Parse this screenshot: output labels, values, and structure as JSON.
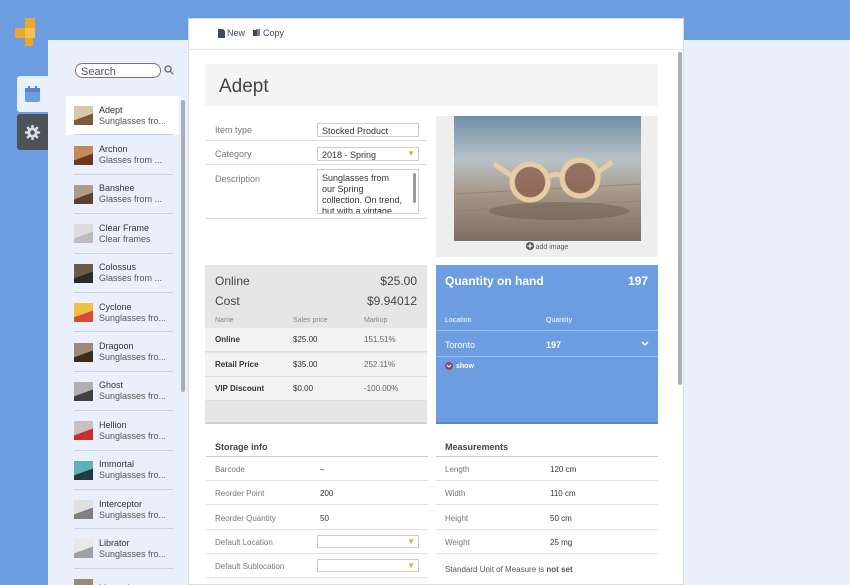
{
  "search": {
    "placeholder": "Search"
  },
  "toolbar": {
    "new_label": "New",
    "copy_label": "Copy"
  },
  "items": [
    {
      "name": "Adept",
      "desc": "Sunglasses fro...",
      "selected": true,
      "thumb": [
        "#d8c8a8",
        "#7a5a3a"
      ]
    },
    {
      "name": "Archon",
      "desc": "Glasses from ...",
      "thumb": [
        "#c58a5a",
        "#6a3a20"
      ]
    },
    {
      "name": "Banshee",
      "desc": "Glasses from ...",
      "thumb": [
        "#b09a8a",
        "#5a4030"
      ]
    },
    {
      "name": "Clear Frame",
      "desc": "Clear frames",
      "thumb": [
        "#dcdcdc",
        "#bcbcbc"
      ]
    },
    {
      "name": "Colossus",
      "desc": "Glasses from ...",
      "thumb": [
        "#6a5a4a",
        "#2a2a2a"
      ]
    },
    {
      "name": "Cyclone",
      "desc": "Sunglasses fro...",
      "thumb": [
        "#f0c040",
        "#d84a3a"
      ]
    },
    {
      "name": "Dragoon",
      "desc": "Sunglasses fro...",
      "thumb": [
        "#a08878",
        "#3a2a20"
      ]
    },
    {
      "name": "Ghost",
      "desc": "Sunglasses fro...",
      "thumb": [
        "#b0b0b0",
        "#404040"
      ]
    },
    {
      "name": "Hellion",
      "desc": "Sunglasses fro...",
      "thumb": [
        "#c8c0c0",
        "#c83030"
      ]
    },
    {
      "name": "Immortal",
      "desc": "Sunglasses fro...",
      "thumb": [
        "#60b0b8",
        "#203a40"
      ]
    },
    {
      "name": "Interceptor",
      "desc": "Sunglasses fro...",
      "thumb": [
        "#e0e0e0",
        "#808080"
      ]
    },
    {
      "name": "Librator",
      "desc": "Sunglasses fro...",
      "thumb": [
        "#e8e8e8",
        "#a0a0a0"
      ]
    },
    {
      "name": "Marauder",
      "desc": "",
      "thumb": [
        "#9a8a7a",
        "#4a3a2a"
      ]
    }
  ],
  "product": {
    "title": "Adept",
    "fields": {
      "item_type_label": "Item type",
      "item_type_value": "Stocked Product",
      "category_label": "Category",
      "category_value": "2018 - Spring",
      "description_label": "Description",
      "description_value": "Sunglasses from our Spring collection. On trend, but with a vintage vibe."
    },
    "add_image": "add image"
  },
  "pricing": {
    "online_label": "Online",
    "online_value": "$25.00",
    "cost_label": "Cost",
    "cost_value": "$9.94012",
    "headers": [
      "Name",
      "Sales price",
      "Markup"
    ],
    "rows": [
      [
        "Online",
        "$25.00",
        "151.51%"
      ],
      [
        "Retail Price",
        "$35.00",
        "252.11%"
      ],
      [
        "VIP Discount",
        "$0.00",
        "-100.00%"
      ]
    ]
  },
  "quantity": {
    "title": "Quantity on hand",
    "value": "197",
    "headers": [
      "Location",
      "Quantity"
    ],
    "row": [
      "Toronto",
      "197"
    ],
    "show_label": "show"
  },
  "storage": {
    "title": "Storage info",
    "rows": [
      [
        "Barcode",
        "–"
      ],
      [
        "Reorder Point",
        "200"
      ],
      [
        "Reorder Quantity",
        "50"
      ],
      [
        "Default Location",
        ""
      ],
      [
        "Default Sublocation",
        ""
      ]
    ]
  },
  "measurements": {
    "title": "Measurements",
    "rows": [
      [
        "Length",
        "120 cm"
      ],
      [
        "Width",
        "110 cm"
      ],
      [
        "Height",
        "50 cm"
      ],
      [
        "Weight",
        "25 mg"
      ]
    ],
    "note_prefix": "Standard Unit of Measure is ",
    "note_value": "not set"
  },
  "colors": {
    "accent": "#6b9de0",
    "orange": "#f2a52b",
    "dark_tab": "#4d5257"
  }
}
